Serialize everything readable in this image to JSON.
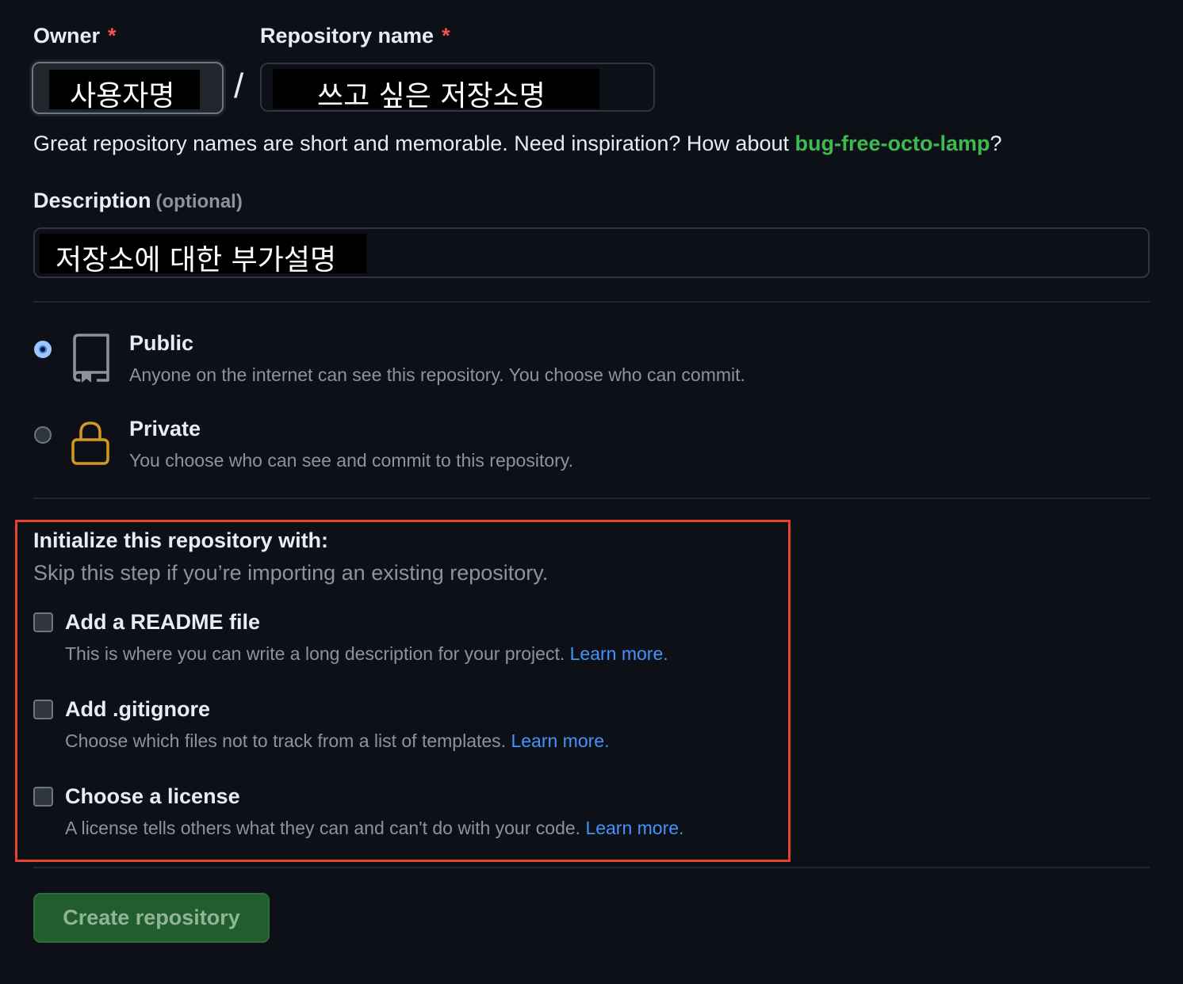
{
  "owner": {
    "label": "Owner",
    "required_mark": "*",
    "value": "사용자명"
  },
  "separator": "/",
  "repository": {
    "label": "Repository name",
    "required_mark": "*",
    "value": "쓰고 싶은 저장소명"
  },
  "hint": {
    "text": "Great repository names are short and memorable. Need inspiration? How about ",
    "suggestion": "bug-free-octo-lamp",
    "end": "?"
  },
  "description": {
    "label": "Description",
    "optional": "(optional)",
    "value": "저장소에 대한 부가설명"
  },
  "visibility": {
    "selected": "public",
    "options": [
      {
        "key": "public",
        "title": "Public",
        "description": "Anyone on the internet can see this repository. You choose who can commit.",
        "icon": "repo-icon"
      },
      {
        "key": "private",
        "title": "Private",
        "description": "You choose who can see and commit to this repository.",
        "icon": "lock-icon"
      }
    ]
  },
  "initialize": {
    "title": "Initialize this repository with:",
    "subtitle": "Skip this step if you’re importing an existing repository.",
    "options": [
      {
        "title": "Add a README file",
        "description": "This is where you can write a long description for your project.",
        "link": "Learn more.",
        "checked": false
      },
      {
        "title": "Add .gitignore",
        "description": "Choose which files not to track from a list of templates.",
        "link": "Learn more.",
        "checked": false
      },
      {
        "title": "Choose a license",
        "description": "A license tells others what they can and can't do with your code.",
        "link": "Learn more.",
        "checked": false
      }
    ]
  },
  "create_button": "Create repository",
  "colors": {
    "background": "#0d1117",
    "accent_green": "#3fb950",
    "link_blue": "#4493f8",
    "required_red": "#f85149",
    "highlight_frame": "#e8412c",
    "button_green": "#225e2d"
  }
}
